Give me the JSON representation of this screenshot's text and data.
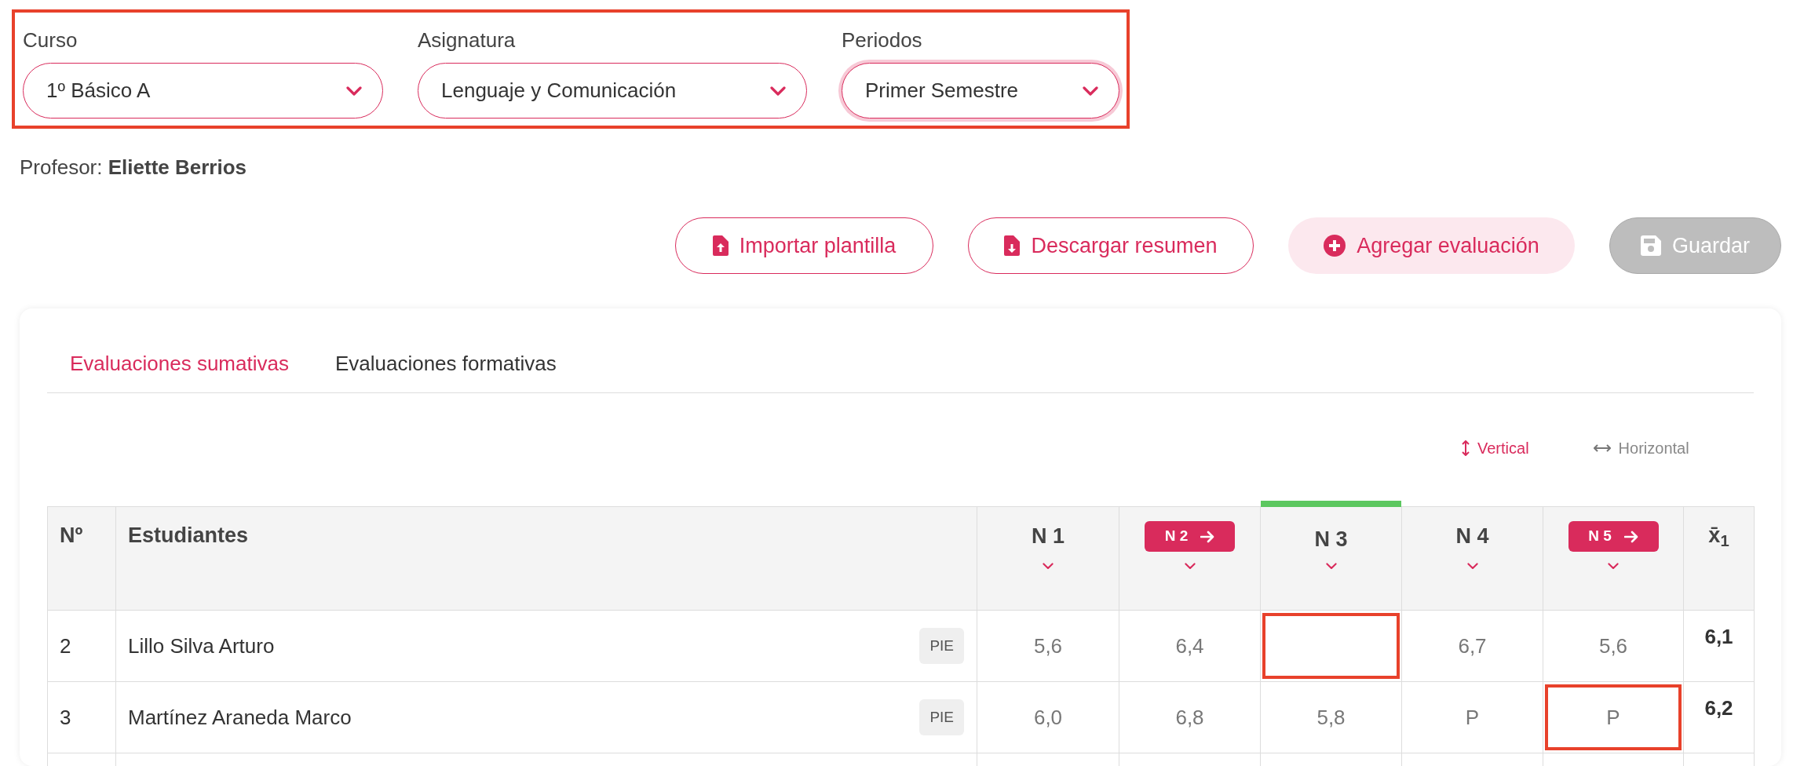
{
  "filters": {
    "highlighted": true,
    "items": [
      {
        "label": "Curso",
        "value": "1º Básico A",
        "focused": false
      },
      {
        "label": "Asignatura",
        "value": "Lenguaje y Comunicación",
        "focused": false
      },
      {
        "label": "Periodos",
        "value": "Primer Semestre",
        "focused": true
      }
    ]
  },
  "teacher": {
    "label": "Profesor:",
    "name": "Eliette Berrios"
  },
  "actions": [
    {
      "kind": "upload",
      "label": "Importar plantilla",
      "disabled": false
    },
    {
      "kind": "download",
      "label": "Descargar resumen",
      "disabled": false
    },
    {
      "kind": "add",
      "label": "Agregar evaluación",
      "disabled": false
    },
    {
      "kind": "save",
      "label": "Guardar",
      "disabled": true
    }
  ],
  "tabs": [
    {
      "label": "Evaluaciones sumativas",
      "selected": true
    },
    {
      "label": "Evaluaciones formativas",
      "selected": false
    }
  ],
  "orientation": [
    {
      "kind": "vertical",
      "label": "Vertical",
      "selected": true
    },
    {
      "kind": "horizontal",
      "label": "Horizontal",
      "selected": false
    }
  ],
  "table": {
    "columns": [
      {
        "kind": "plain",
        "label": "Nº"
      },
      {
        "kind": "plain",
        "label": "Estudiantes"
      },
      {
        "kind": "grade",
        "label": "N 1",
        "linked": false,
        "active": false
      },
      {
        "kind": "grade",
        "label": "N 2",
        "linked": true,
        "active": false
      },
      {
        "kind": "grade",
        "label": "N 3",
        "linked": false,
        "active": true
      },
      {
        "kind": "grade",
        "label": "N 4",
        "linked": false,
        "active": false
      },
      {
        "kind": "grade",
        "label": "N 5",
        "linked": true,
        "active": false
      },
      {
        "kind": "average",
        "label": "x̄$_{1}$"
      }
    ],
    "rows": [
      {
        "number": "2",
        "student": "Lillo Silva Arturo",
        "tag": "PIE",
        "grades": [
          {
            "value": "5,6",
            "highlighted": false
          },
          {
            "value": "6,4",
            "highlighted": false
          },
          {
            "highlighted": true
          },
          {
            "value": "6,7",
            "highlighted": false
          },
          {
            "value": "5,6",
            "highlighted": false
          }
        ],
        "average": "6,1"
      },
      {
        "number": "3",
        "student": "Martínez Araneda Marco",
        "tag": "PIE",
        "grades": [
          {
            "value": "6,0",
            "highlighted": false
          },
          {
            "value": "6,8",
            "highlighted": false
          },
          {
            "value": "5,8",
            "highlighted": false
          },
          {
            "value": "P",
            "highlighted": false
          },
          {
            "value": "P",
            "highlighted": true
          }
        ],
        "average": "6,2"
      }
    ]
  }
}
